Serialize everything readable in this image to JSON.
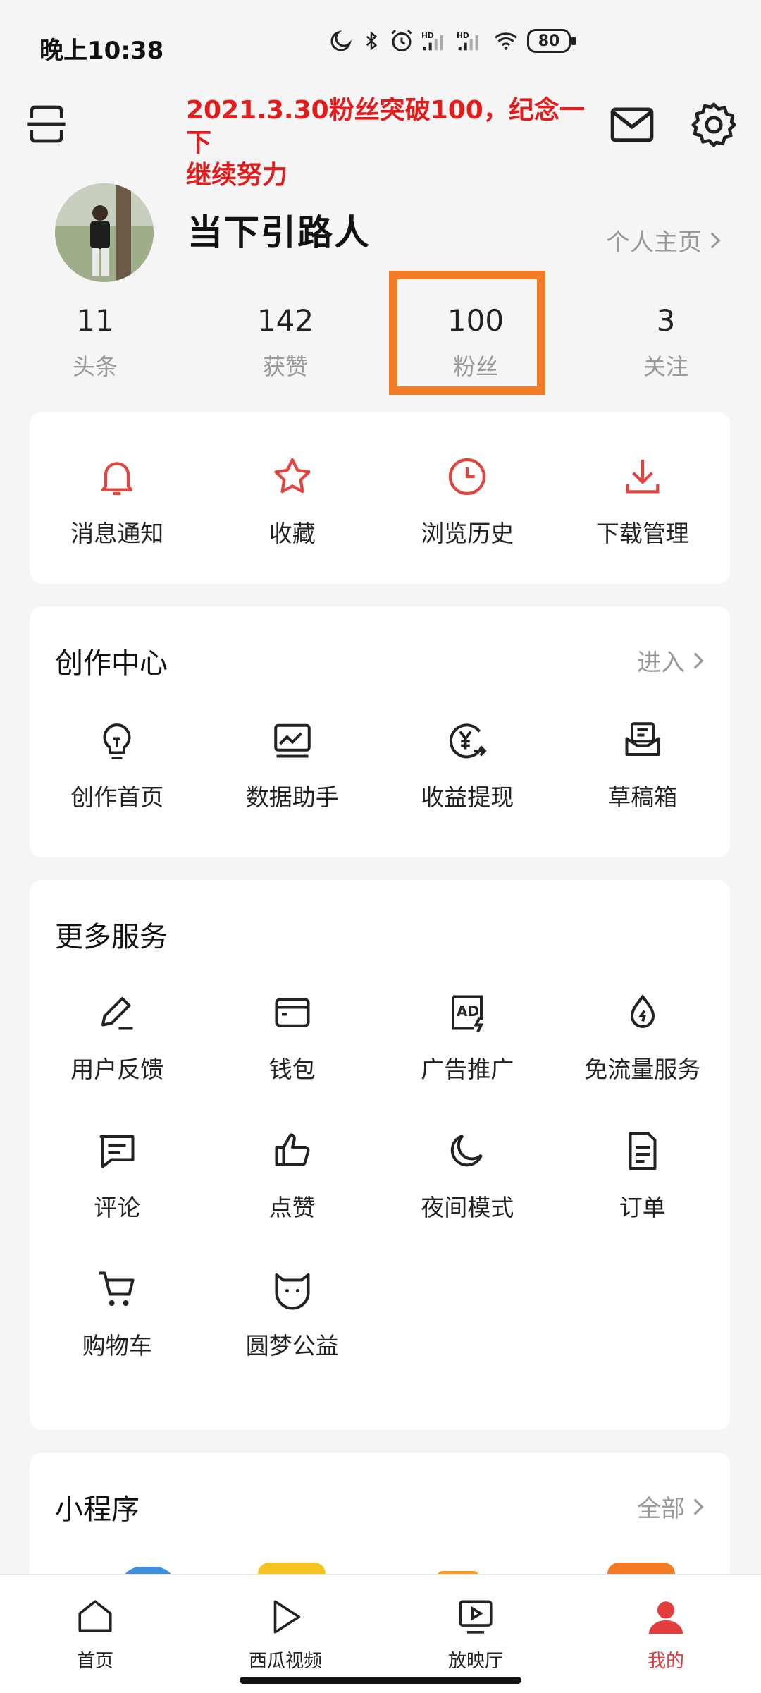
{
  "status_bar": {
    "time": "晚上10:38",
    "battery": "80"
  },
  "annotation": {
    "line1": "2021.3.30粉丝突破100，纪念一下",
    "line2": "继续努力"
  },
  "profile": {
    "username": "当下引路人",
    "homepage_link": "个人主页"
  },
  "stats": [
    {
      "value": "11",
      "label": "头条"
    },
    {
      "value": "142",
      "label": "获赞"
    },
    {
      "value": "100",
      "label": "粉丝"
    },
    {
      "value": "3",
      "label": "关注"
    }
  ],
  "quick_actions": [
    {
      "label": "消息通知",
      "icon": "bell-icon"
    },
    {
      "label": "收藏",
      "icon": "star-icon"
    },
    {
      "label": "浏览历史",
      "icon": "clock-icon"
    },
    {
      "label": "下载管理",
      "icon": "download-icon"
    }
  ],
  "creator_center": {
    "title": "创作中心",
    "more": "进入",
    "items": [
      {
        "label": "创作首页",
        "icon": "lightbulb-icon"
      },
      {
        "label": "数据助手",
        "icon": "chart-icon"
      },
      {
        "label": "收益提现",
        "icon": "yen-icon"
      },
      {
        "label": "草稿箱",
        "icon": "draft-box-icon"
      }
    ]
  },
  "more_services": {
    "title": "更多服务",
    "items": [
      {
        "label": "用户反馈",
        "icon": "pen-icon"
      },
      {
        "label": "钱包",
        "icon": "wallet-icon"
      },
      {
        "label": "广告推广",
        "icon": "ad-icon"
      },
      {
        "label": "免流量服务",
        "icon": "drop-icon"
      },
      {
        "label": "评论",
        "icon": "comment-icon"
      },
      {
        "label": "点赞",
        "icon": "thumb-up-icon"
      },
      {
        "label": "夜间模式",
        "icon": "moon-icon"
      },
      {
        "label": "订单",
        "icon": "document-icon"
      },
      {
        "label": "购物车",
        "icon": "cart-icon"
      },
      {
        "label": "圆梦公益",
        "icon": "cat-face-icon"
      }
    ]
  },
  "mini_programs": {
    "title": "小程序",
    "more": "全部"
  },
  "tabbar": [
    {
      "label": "首页",
      "icon": "home-icon"
    },
    {
      "label": "西瓜视频",
      "icon": "play-icon"
    },
    {
      "label": "放映厅",
      "icon": "tv-icon"
    },
    {
      "label": "我的",
      "icon": "person-icon",
      "active": true
    }
  ],
  "colors": {
    "accent_red": "#e43d3d",
    "annotation_red": "#e31b1b",
    "highlight_orange": "#f57c26"
  }
}
